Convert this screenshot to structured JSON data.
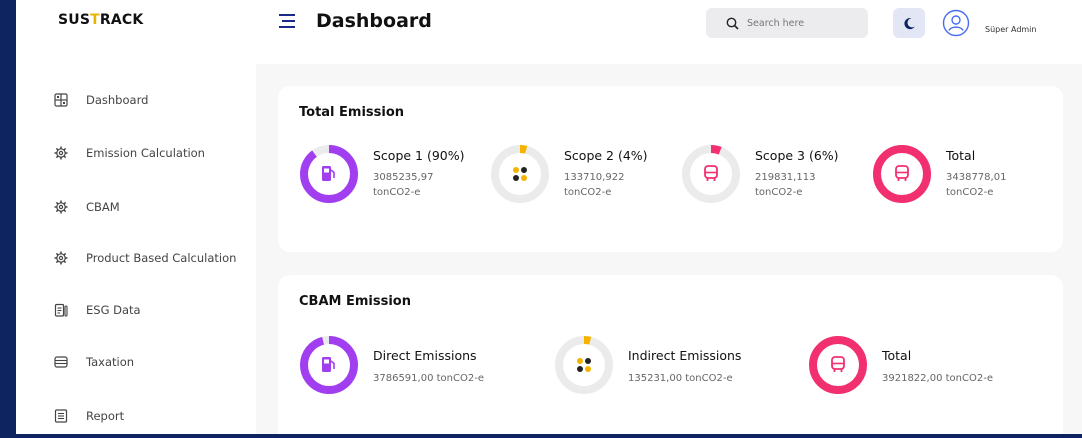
{
  "app": {
    "logo_prefix": "SUS",
    "logo_accent": "T",
    "logo_suffix": "RACK"
  },
  "colors": {
    "brand_dark": "#0d2461",
    "purple": "#a13ff0",
    "yellow": "#f5b300",
    "pink": "#f3306f",
    "ring_track": "#ebebeb"
  },
  "sidebar": {
    "items": [
      {
        "label": "Dashboard",
        "icon": "dashboard-icon"
      },
      {
        "label": "Emission Calculation",
        "icon": "gear-icon"
      },
      {
        "label": "CBAM",
        "icon": "gear-icon"
      },
      {
        "label": "Product Based Calculation",
        "icon": "gear-icon"
      },
      {
        "label": "ESG Data",
        "icon": "clipboard-icon"
      },
      {
        "label": "Taxation",
        "icon": "database-icon"
      },
      {
        "label": "Report",
        "icon": "document-icon"
      }
    ]
  },
  "header": {
    "title": "Dashboard",
    "search_placeholder": "Search here",
    "user_name": "Süper Admin"
  },
  "total_emission": {
    "title": "Total Emission",
    "items": [
      {
        "label": "Scope 1 (90%)",
        "value": "3085235,97",
        "unit": "tonCO2-e",
        "fill": 0.9,
        "icon": "fuel-pump-icon"
      },
      {
        "label": "Scope 2 (4%)",
        "value": "133710,922",
        "unit": "tonCO2-e",
        "fill": 0.04,
        "icon": "dots-icon"
      },
      {
        "label": "Scope 3 (6%)",
        "value": "219831,113",
        "unit": "tonCO2-e",
        "fill": 0.06,
        "icon": "bus-icon"
      },
      {
        "label": "Total",
        "value": "3438778,01",
        "unit": "tonCO2-e",
        "fill": 1.0,
        "icon": "bus-icon"
      }
    ]
  },
  "cbam_emission": {
    "title": "CBAM Emission",
    "items": [
      {
        "label": "Direct Emissions",
        "value": "3786591,00 tonCO2-e",
        "fill": 0.96,
        "icon": "fuel-pump-icon"
      },
      {
        "label": "Indirect Emissions",
        "value": "135231,00 tonCO2-e",
        "fill": 0.04,
        "icon": "dots-icon"
      },
      {
        "label": "Total",
        "value": "3921822,00 tonCO2-e",
        "fill": 1.0,
        "icon": "bus-icon"
      }
    ]
  }
}
